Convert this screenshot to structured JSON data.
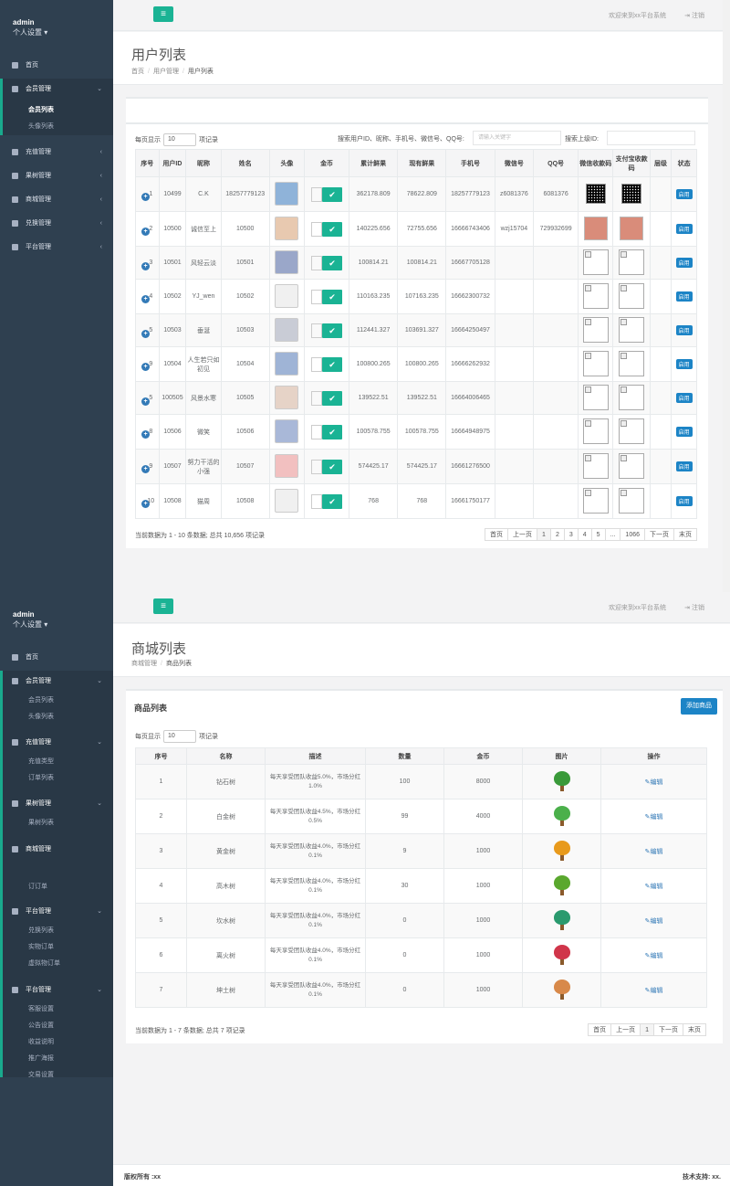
{
  "common": {
    "admin": "admin",
    "personal": "个人设置",
    "welcome": "欢迎来到xx平台系统",
    "logout": "注销",
    "menu_icon": "hamburger-icon"
  },
  "s1": {
    "sidebar": {
      "home": "首页",
      "member_mgmt": "会员管理",
      "member_list": "会员列表",
      "avatar_list": "头像列表",
      "recharge_mgmt": "充值管理",
      "fruit_mgmt": "果树管理",
      "shop_mgmt": "商城管理",
      "exchange_mgmt": "兑换管理",
      "platform_mgmt": "平台管理"
    },
    "title": "用户列表",
    "breadcrumb": [
      "首页",
      "用户管理",
      "用户列表"
    ],
    "show_prefix": "每页显示",
    "show_value": "10",
    "show_suffix": "项记录",
    "search_label": "搜索用户ID、昵称、手机号、微信号、QQ号:",
    "search_placeholder": "请输入关键字",
    "search_parent_label": "搜索上级ID:",
    "columns": [
      "序号",
      "用户ID",
      "昵称",
      "姓名",
      "头像",
      "金币",
      "累计鲜果",
      "现有鲜果",
      "手机号",
      "微信号",
      "QQ号",
      "微信收款码",
      "支付宝收款码",
      "层级",
      "状态"
    ],
    "rows": [
      {
        "no": "1",
        "id": "10499",
        "nick": "C.K",
        "name": "18257779123",
        "gold": "",
        "total": "362178.809",
        "current": "78622.809",
        "phone": "18257779123",
        "wechat": "z6081376",
        "qq": "6081376",
        "wxcode": "qr",
        "alicode": "qr",
        "level": "",
        "status": "启用",
        "avatar_color": "#8fb3d9"
      },
      {
        "no": "2",
        "id": "10500",
        "nick": "诚信至上",
        "name": "10500",
        "gold": "",
        "total": "140225.656",
        "current": "72755.656",
        "phone": "16666743406",
        "wechat": "wzj15704",
        "qq": "729932699",
        "wxcode": "photo",
        "alicode": "photo",
        "level": "",
        "status": "启用",
        "avatar_color": "#e8c9b0"
      },
      {
        "no": "3",
        "id": "10501",
        "nick": "风轻云淡",
        "name": "10501",
        "gold": "",
        "total": "100814.21",
        "current": "100814.21",
        "phone": "16667705128",
        "wechat": "",
        "qq": "",
        "wxcode": "broken",
        "alicode": "broken",
        "level": "",
        "status": "启用",
        "avatar_color": "#9aa7c9"
      },
      {
        "no": "4",
        "id": "10502",
        "nick": "YJ_wen",
        "name": "10502",
        "gold": "",
        "total": "110163.235",
        "current": "107163.235",
        "phone": "16662300732",
        "wechat": "",
        "qq": "",
        "wxcode": "broken",
        "alicode": "broken",
        "level": "",
        "status": "启用",
        "avatar_color": "#f0f0f0"
      },
      {
        "no": "5",
        "id": "10503",
        "nick": "垂涎",
        "name": "10503",
        "gold": "",
        "total": "112441.327",
        "current": "103691.327",
        "phone": "16664250497",
        "wechat": "",
        "qq": "",
        "wxcode": "broken",
        "alicode": "broken",
        "level": "",
        "status": "启用",
        "avatar_color": "#c9ccd6"
      },
      {
        "no": "9",
        "id": "10504",
        "nick": "人生若只如初见",
        "name": "10504",
        "gold": "",
        "total": "100800.265",
        "current": "100800.265",
        "phone": "16666262932",
        "wechat": "",
        "qq": "",
        "wxcode": "broken",
        "alicode": "broken",
        "level": "",
        "status": "启用",
        "avatar_color": "#9fb4d6"
      },
      {
        "no": "5",
        "id": "100505",
        "nick": "风景水寒",
        "name": "10505",
        "gold": "",
        "total": "139522.51",
        "current": "139522.51",
        "phone": "16664006465",
        "wechat": "",
        "qq": "",
        "wxcode": "broken",
        "alicode": "broken",
        "level": "",
        "status": "启用",
        "avatar_color": "#e6d3c7"
      },
      {
        "no": "8",
        "id": "10506",
        "nick": "微笑",
        "name": "10506",
        "gold": "",
        "total": "100578.755",
        "current": "100578.755",
        "phone": "16664948975",
        "wechat": "",
        "qq": "",
        "wxcode": "broken",
        "alicode": "broken",
        "level": "",
        "status": "启用",
        "avatar_color": "#a9b8d8"
      },
      {
        "no": "9",
        "id": "10507",
        "nick": "努力干活的小强",
        "name": "10507",
        "gold": "",
        "total": "574425.17",
        "current": "574425.17",
        "phone": "16661276500",
        "wechat": "",
        "qq": "",
        "wxcode": "broken",
        "alicode": "broken",
        "level": "",
        "status": "启用",
        "avatar_color": "#f2c0c0"
      },
      {
        "no": "10",
        "id": "10508",
        "nick": "猫周",
        "name": "10508",
        "gold": "",
        "total": "768",
        "current": "768",
        "phone": "16661750177",
        "wechat": "",
        "qq": "",
        "wxcode": "broken",
        "alicode": "broken",
        "level": "",
        "status": "启用",
        "avatar_color": "#f0f0f0"
      }
    ],
    "info": "当前数据为 1 - 10 条数据; 总共 10,656 项记录",
    "pager": [
      "首页",
      "上一页",
      "1",
      "2",
      "3",
      "4",
      "5",
      "...",
      "1066",
      "下一页",
      "末页"
    ]
  },
  "s2": {
    "sidebar": {
      "home": "首页",
      "member_mgmt": "会员管理",
      "member_list": "会员列表",
      "avatar_list": "头像列表",
      "recharge_mgmt": "充值管理",
      "recharge_type": "充值类型",
      "order_list": "订单列表",
      "fruit_mgmt": "果树管理",
      "fruit_list": "果树列表",
      "shop_mgmt": "商城管理",
      "order_orders": "订订单",
      "exchange_mgmt": "平台管理",
      "exchange_list": "兑换列表",
      "physical_orders": "实物订单",
      "virtual_orders": "虚拟物订单",
      "platform_mgmt": "平台管理",
      "service_settings": "客服设置",
      "notice_settings": "公告设置",
      "income_desc": "收益说明",
      "promo_poster": "推广海报",
      "trade_settings": "交易设置"
    },
    "title": "商城列表",
    "breadcrumb": [
      "商城管理",
      "商品列表"
    ],
    "box_title": "商品列表",
    "add_btn": "添加商品",
    "show_prefix": "每页显示",
    "show_value": "10",
    "show_suffix": "项记录",
    "columns": [
      "序号",
      "名称",
      "描述",
      "数量",
      "金币",
      "图片",
      "操作"
    ],
    "rows": [
      {
        "no": "1",
        "name": "钻石树",
        "desc": "每天享受团队收益5.0%，市场分红1.0%",
        "qty": "100",
        "gold": "8000",
        "color": "#3a9a3a",
        "op": "编辑"
      },
      {
        "no": "2",
        "name": "白金树",
        "desc": "每天享受团队收益4.5%，市场分红0.5%",
        "qty": "99",
        "gold": "4000",
        "color": "#4bb04b",
        "op": "编辑"
      },
      {
        "no": "3",
        "name": "黄金树",
        "desc": "每天享受团队收益4.0%，市场分红0.1%",
        "qty": "9",
        "gold": "1000",
        "color": "#e89a1c",
        "op": "编辑"
      },
      {
        "no": "4",
        "name": "高木树",
        "desc": "每天享受团队收益4.0%，市场分红0.1%",
        "qty": "30",
        "gold": "1000",
        "color": "#5aa82e",
        "op": "编辑"
      },
      {
        "no": "5",
        "name": "坎水树",
        "desc": "每天享受团队收益4.0%，市场分红0.1%",
        "qty": "0",
        "gold": "1000",
        "color": "#2a9a6e",
        "op": "编辑"
      },
      {
        "no": "6",
        "name": "离火树",
        "desc": "每天享受团队收益4.0%，市场分红0.1%",
        "qty": "0",
        "gold": "1000",
        "color": "#d0354a",
        "op": "编辑"
      },
      {
        "no": "7",
        "name": "坤土树",
        "desc": "每天享受团队收益4.0%，市场分红0.1%",
        "qty": "0",
        "gold": "1000",
        "color": "#d8894a",
        "op": "编辑"
      }
    ],
    "info": "当前数据为 1 - 7 条数据; 总共 7 项记录",
    "pager": [
      "首页",
      "上一页",
      "1",
      "下一页",
      "末页"
    ],
    "footer_left": "版权所有 :xx",
    "footer_right": "技术支持: xx."
  }
}
